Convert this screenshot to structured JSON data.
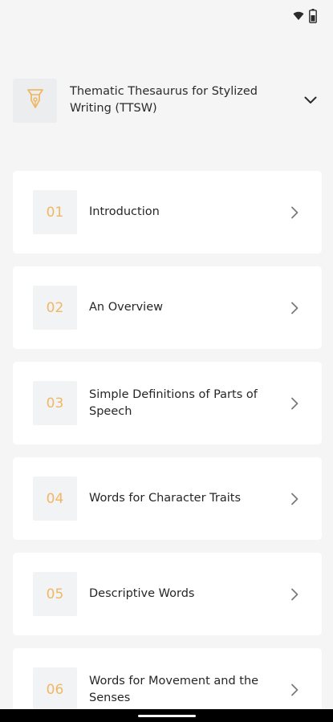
{
  "status_bar": {
    "icons": [
      "wifi-icon",
      "battery-icon"
    ]
  },
  "header": {
    "logo_icon": "pen-nib-icon",
    "title": "Thematic Thesaurus for Stylized Writing (TTSW)",
    "expand_icon": "chevron-down-icon"
  },
  "chapters": [
    {
      "number": "01",
      "title": "Introduction"
    },
    {
      "number": "02",
      "title": "An Overview"
    },
    {
      "number": "03",
      "title": "Simple Definitions of Parts of Speech"
    },
    {
      "number": "04",
      "title": "Words for Character Traits"
    },
    {
      "number": "05",
      "title": "Descriptive Words"
    },
    {
      "number": "06",
      "title": "Words for Movement and the Senses"
    }
  ],
  "colors": {
    "accent": "#f0b765",
    "background": "#f5f5f6",
    "card": "#ffffff",
    "text": "#262626"
  }
}
